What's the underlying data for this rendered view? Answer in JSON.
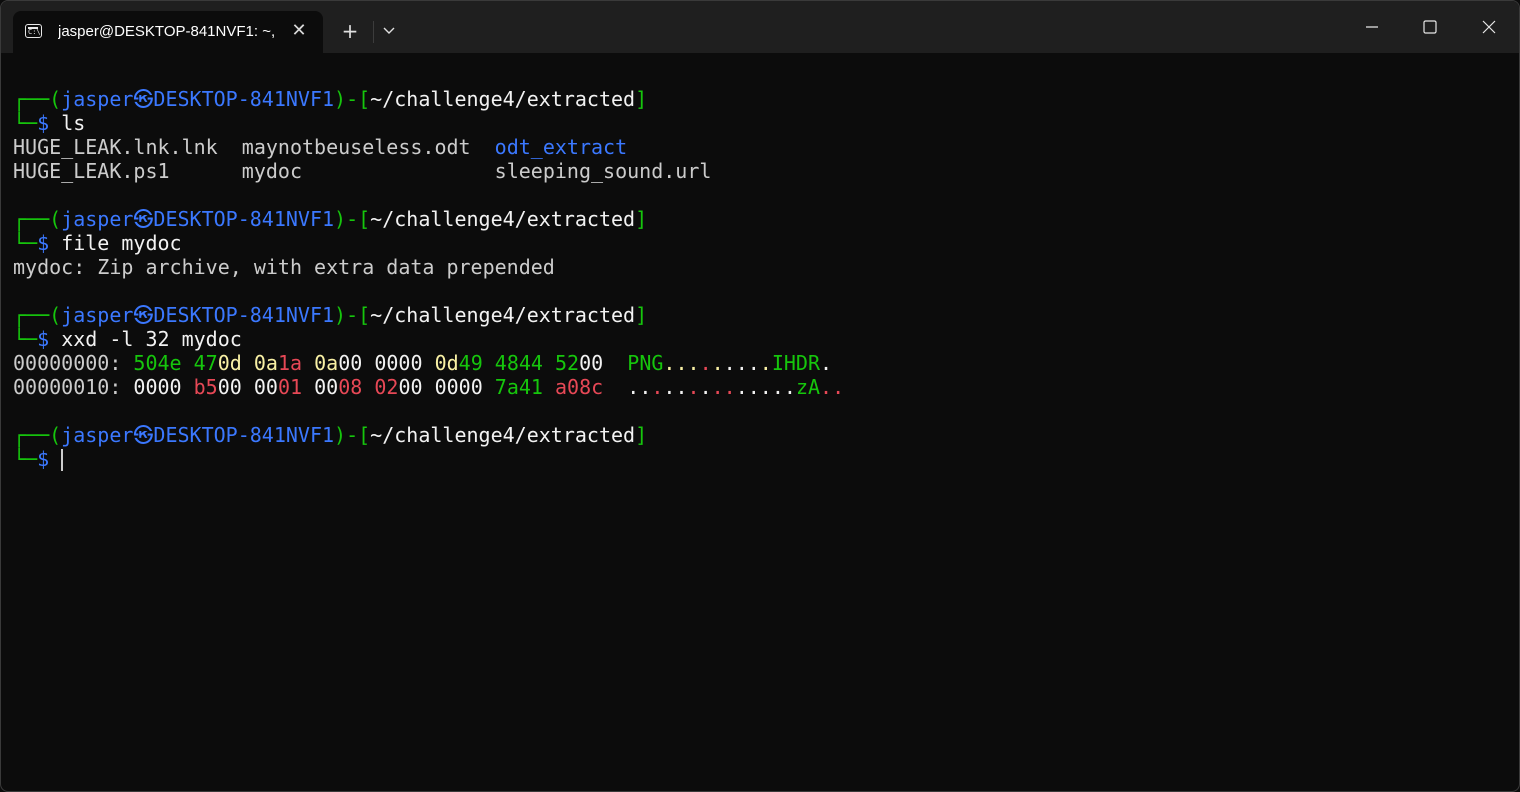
{
  "window": {
    "tab_title": "jasper@DESKTOP-841NVF1: ~,",
    "tab_icon_glyph": "C:\\",
    "new_tab_label": "+"
  },
  "colors": {
    "green": "#16c60c",
    "blue": "#3b78ff",
    "white": "#f2f2f2",
    "yellow": "#f9f1a5",
    "red": "#e74856",
    "gray": "#cccccc"
  },
  "prompt": {
    "corner_top": "┌──(",
    "user": "jasper",
    "sep": "㉿",
    "host": "DESKTOP-841NVF1",
    "mid": ")-[",
    "path": "~/challenge4/extracted",
    "close": "]",
    "corner_bottom": "└─",
    "dollar": "$"
  },
  "blocks": [
    {
      "command": "ls",
      "output": [
        [
          {
            "t": "HUGE_LEAK.lnk.lnk  ",
            "c": "gr"
          },
          {
            "t": "maynotbeuseless.odt  ",
            "c": "gr"
          },
          {
            "t": "odt_extract",
            "c": "b"
          }
        ],
        [
          {
            "t": "HUGE_LEAK.ps1      ",
            "c": "gr"
          },
          {
            "t": "mydoc                ",
            "c": "gr"
          },
          {
            "t": "sleeping_sound.url",
            "c": "gr"
          }
        ]
      ]
    },
    {
      "command": "file mydoc",
      "output": [
        [
          {
            "t": "mydoc: Zip archive, with extra data prepended",
            "c": "gr"
          }
        ]
      ]
    },
    {
      "command": "xxd -l 32 mydoc",
      "output": [
        [
          {
            "t": "00000000: ",
            "c": "gr"
          },
          {
            "t": "504e",
            "c": "g"
          },
          {
            "t": " ",
            "c": "gr"
          },
          {
            "t": "47",
            "c": "g"
          },
          {
            "t": "0d",
            "c": "y"
          },
          {
            "t": " ",
            "c": "gr"
          },
          {
            "t": "0a",
            "c": "y"
          },
          {
            "t": "1a",
            "c": "r"
          },
          {
            "t": " ",
            "c": "gr"
          },
          {
            "t": "0a",
            "c": "y"
          },
          {
            "t": "00",
            "c": "w"
          },
          {
            "t": " ",
            "c": "gr"
          },
          {
            "t": "0000",
            "c": "w"
          },
          {
            "t": " ",
            "c": "gr"
          },
          {
            "t": "0d",
            "c": "y"
          },
          {
            "t": "49",
            "c": "g"
          },
          {
            "t": " ",
            "c": "gr"
          },
          {
            "t": "4844",
            "c": "g"
          },
          {
            "t": " ",
            "c": "gr"
          },
          {
            "t": "52",
            "c": "g"
          },
          {
            "t": "00",
            "c": "w"
          },
          {
            "t": "  ",
            "c": "gr"
          },
          {
            "t": "PNG",
            "c": "g"
          },
          {
            "t": ".",
            "c": "y"
          },
          {
            "t": ".",
            "c": "y"
          },
          {
            "t": ".",
            "c": "y"
          },
          {
            "t": ".",
            "c": "r"
          },
          {
            "t": ".",
            "c": "y"
          },
          {
            "t": ".",
            "c": "w"
          },
          {
            "t": ".",
            "c": "w"
          },
          {
            "t": ".",
            "c": "w"
          },
          {
            "t": ".",
            "c": "y"
          },
          {
            "t": "IHDR",
            "c": "g"
          },
          {
            "t": ".",
            "c": "w"
          }
        ],
        [
          {
            "t": "00000010: ",
            "c": "gr"
          },
          {
            "t": "0000",
            "c": "w"
          },
          {
            "t": " ",
            "c": "gr"
          },
          {
            "t": "b5",
            "c": "r"
          },
          {
            "t": "00",
            "c": "w"
          },
          {
            "t": " ",
            "c": "gr"
          },
          {
            "t": "00",
            "c": "w"
          },
          {
            "t": "01",
            "c": "r"
          },
          {
            "t": " ",
            "c": "gr"
          },
          {
            "t": "00",
            "c": "w"
          },
          {
            "t": "08",
            "c": "r"
          },
          {
            "t": " ",
            "c": "gr"
          },
          {
            "t": "02",
            "c": "r"
          },
          {
            "t": "00",
            "c": "w"
          },
          {
            "t": " ",
            "c": "gr"
          },
          {
            "t": "0000",
            "c": "w"
          },
          {
            "t": " ",
            "c": "gr"
          },
          {
            "t": "7a41",
            "c": "g"
          },
          {
            "t": " ",
            "c": "gr"
          },
          {
            "t": "a08c",
            "c": "r"
          },
          {
            "t": "  ",
            "c": "gr"
          },
          {
            "t": ".",
            "c": "w"
          },
          {
            "t": ".",
            "c": "w"
          },
          {
            "t": ".",
            "c": "r"
          },
          {
            "t": ".",
            "c": "w"
          },
          {
            "t": ".",
            "c": "w"
          },
          {
            "t": ".",
            "c": "r"
          },
          {
            "t": ".",
            "c": "w"
          },
          {
            "t": ".",
            "c": "r"
          },
          {
            "t": ".",
            "c": "r"
          },
          {
            "t": ".",
            "c": "w"
          },
          {
            "t": ".",
            "c": "w"
          },
          {
            "t": ".",
            "c": "w"
          },
          {
            "t": ".",
            "c": "w"
          },
          {
            "t": ".",
            "c": "w"
          },
          {
            "t": "zA",
            "c": "g"
          },
          {
            "t": ".",
            "c": "r"
          },
          {
            "t": ".",
            "c": "r"
          }
        ]
      ]
    },
    {
      "command": "",
      "output": []
    }
  ]
}
